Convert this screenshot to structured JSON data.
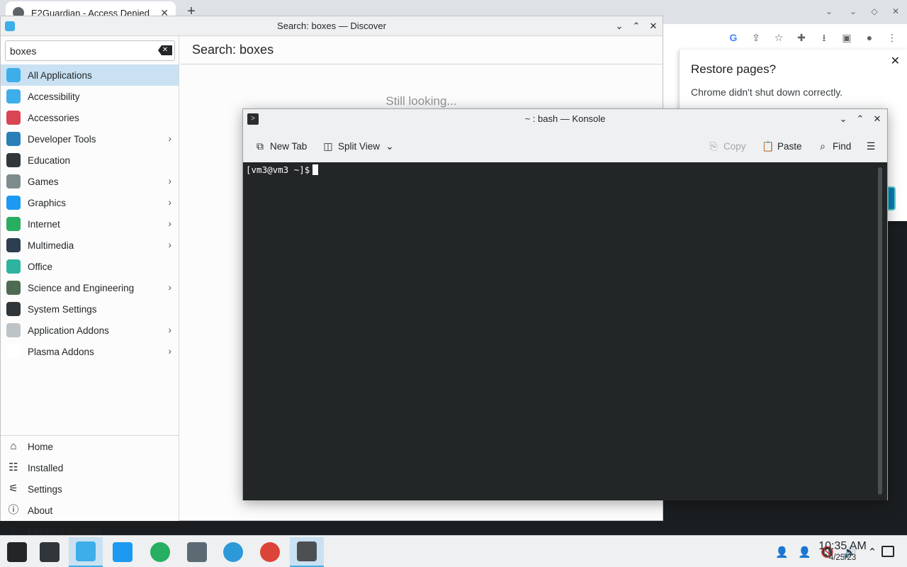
{
  "chrome": {
    "tab_title": "E2Guardian - Access Denied",
    "tab_close": "✕",
    "new_tab": "+",
    "controls": [
      "⌄",
      "⌃",
      "◇",
      "⌄"
    ],
    "toolbar_icons": [
      "G",
      "⇪",
      "☆",
      "✚",
      "⭳",
      "▣",
      "●",
      "⋮"
    ],
    "restore": {
      "title": "Restore pages?",
      "body": "Chrome didn't shut down correctly.",
      "close": "✕"
    }
  },
  "discover": {
    "window_title": "Search: boxes — Discover",
    "window_buttons": [
      "⌄",
      "⌃",
      "✕"
    ],
    "search_value": "boxes",
    "clear_icon": "✕",
    "heading": "Search: boxes",
    "status": "Still looking...",
    "categories": [
      {
        "label": "All Applications",
        "icon": "grid-icon",
        "color": "#3daee9",
        "submenu": false,
        "active": true
      },
      {
        "label": "Accessibility",
        "icon": "accessibility-icon",
        "color": "#3daee9",
        "submenu": false
      },
      {
        "label": "Accessories",
        "icon": "toolbox-icon",
        "color": "#da4453",
        "submenu": false
      },
      {
        "label": "Developer Tools",
        "icon": "wrench-icon",
        "color": "#2980b9",
        "submenu": true
      },
      {
        "label": "Education",
        "icon": "chalkboard-icon",
        "color": "#31363b",
        "submenu": false
      },
      {
        "label": "Games",
        "icon": "gamepad-icon",
        "color": "#7f8c8d",
        "submenu": true
      },
      {
        "label": "Graphics",
        "icon": "sphere-icon",
        "color": "#1d99f3",
        "submenu": true
      },
      {
        "label": "Internet",
        "icon": "globe-icon",
        "color": "#27ae60",
        "submenu": true
      },
      {
        "label": "Multimedia",
        "icon": "media-icon",
        "color": "#2c3e50",
        "submenu": true
      },
      {
        "label": "Office",
        "icon": "office-icon",
        "color": "#2eb3a0",
        "submenu": false
      },
      {
        "label": "Science and Engineering",
        "icon": "flask-icon",
        "color": "#4d6b53",
        "submenu": true
      },
      {
        "label": "System Settings",
        "icon": "settings-panel-icon",
        "color": "#31363b",
        "submenu": false
      },
      {
        "label": "Application Addons",
        "icon": "dots-icon",
        "color": "#bdc3c7",
        "submenu": true
      },
      {
        "label": "Plasma Addons",
        "icon": "plasma-icon",
        "color": "#ffffff",
        "submenu": true
      }
    ],
    "chevron": "›",
    "bottom_nav": [
      {
        "label": "Home",
        "icon": "home-icon",
        "glyph": "⌂"
      },
      {
        "label": "Installed",
        "icon": "installed-icon",
        "glyph": "☷"
      },
      {
        "label": "Settings",
        "icon": "sliders-icon",
        "glyph": "⚟"
      },
      {
        "label": "About",
        "icon": "info-icon",
        "glyph": "ⓘ"
      },
      {
        "label": "Fetching updates...",
        "icon": "update-icon",
        "glyph": "⇧"
      }
    ]
  },
  "konsole": {
    "window_title": "~ : bash — Konsole",
    "window_buttons": [
      "⌄",
      "⌃",
      "✕"
    ],
    "app_icon": ">",
    "toolbar": {
      "new_tab": "New Tab",
      "split_view": "Split View",
      "copy": "Copy",
      "paste": "Paste",
      "find": "Find",
      "menu": "☰",
      "dropdown": "⌄"
    },
    "prompt": "[vm3@vm3 ~]$"
  },
  "taskbar": {
    "items": [
      {
        "name": "app-launcher",
        "color": "#232629",
        "active": false
      },
      {
        "name": "system-settings",
        "color": "#31363b",
        "active": false
      },
      {
        "name": "discover",
        "color": "#3daee9",
        "active": true
      },
      {
        "name": "file-manager",
        "color": "#1d99f3",
        "active": false
      },
      {
        "name": "web-browser",
        "color": "#27ae60",
        "active": false
      },
      {
        "name": "kdeconnect",
        "color": "#5c6b73",
        "active": false
      },
      {
        "name": "network",
        "color": "#2c9ad8",
        "active": false
      },
      {
        "name": "chrome",
        "color": "#db4437",
        "active": false
      },
      {
        "name": "konsole",
        "color": "#4d5053",
        "active": true
      }
    ],
    "tray": [
      "👤",
      "👤",
      "🔇",
      "🔊",
      "⌃"
    ],
    "clock_time": "10:35 AM",
    "clock_date": "4/25/23"
  }
}
